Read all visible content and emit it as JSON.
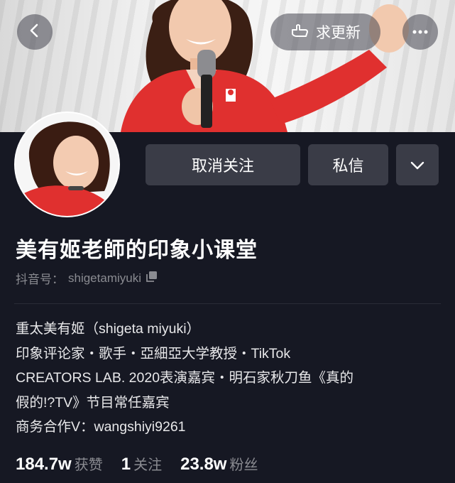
{
  "header": {
    "back_icon": "chevron-left-icon",
    "request_update_label": "求更新",
    "request_update_icon": "hand-point-icon",
    "more_icon": "more-horizontal-icon"
  },
  "profile": {
    "actions": {
      "unfollow_label": "取消关注",
      "message_label": "私信",
      "expand_icon": "chevron-down-icon"
    },
    "name": "美有姬老師的印象小课堂",
    "douyin_id_prefix": "抖音号：",
    "douyin_id": "shigetamiyuki",
    "copy_icon": "copy-icon",
    "bio_lines": [
      "重太美有姬（shigeta miyuki）",
      "印象评论家・歌手・亞細亞大学教授・TikTok",
      "CREATORS LAB. 2020表演嘉宾・明石家秋刀鱼《真的",
      "假的!?TV》节目常任嘉宾",
      "商务合作V：wangshiyi9261"
    ]
  },
  "stats": [
    {
      "value": "184.7w",
      "label": "获赞"
    },
    {
      "value": "1",
      "label": "关注"
    },
    {
      "value": "23.8w",
      "label": "粉丝"
    }
  ],
  "colors": {
    "background": "#161823",
    "button": "#3a3c47",
    "jacket_red": "#e0302f",
    "muted_text": "#8a8b91"
  }
}
